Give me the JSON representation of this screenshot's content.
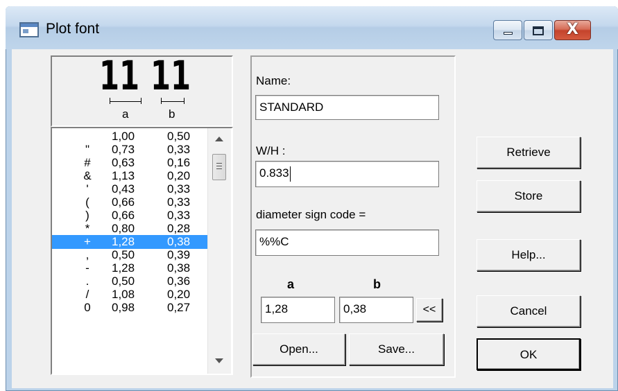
{
  "window": {
    "title": "Plot font",
    "minimize_label": "",
    "maximize_label": "",
    "close_label": "X"
  },
  "preview": {
    "sample_text": "11",
    "label_a": "a",
    "label_b": "b"
  },
  "char_list": {
    "rows": [
      {
        "char": "",
        "a": "1,00",
        "b": "0,50",
        "selected": false
      },
      {
        "char": "\"",
        "a": "0,73",
        "b": "0,33",
        "selected": false
      },
      {
        "char": "#",
        "a": "0,63",
        "b": "0,16",
        "selected": false
      },
      {
        "char": "&",
        "a": "1,13",
        "b": "0,20",
        "selected": false
      },
      {
        "char": "'",
        "a": "0,43",
        "b": "0,33",
        "selected": false
      },
      {
        "char": "(",
        "a": "0,66",
        "b": "0,33",
        "selected": false
      },
      {
        "char": ")",
        "a": "0,66",
        "b": "0,33",
        "selected": false
      },
      {
        "char": "*",
        "a": "0,80",
        "b": "0,28",
        "selected": false
      },
      {
        "char": "+",
        "a": "1,28",
        "b": "0,38",
        "selected": true
      },
      {
        "char": ",",
        "a": "0,50",
        "b": "0,39",
        "selected": false
      },
      {
        "char": "-",
        "a": "1,28",
        "b": "0,38",
        "selected": false
      },
      {
        "char": ".",
        "a": "0,50",
        "b": "0,36",
        "selected": false
      },
      {
        "char": "/",
        "a": "1,08",
        "b": "0,20",
        "selected": false
      },
      {
        "char": "0",
        "a": "0,98",
        "b": "0,27",
        "selected": false
      }
    ]
  },
  "form": {
    "name_label": "Name:",
    "name_value": "STANDARD",
    "wh_label": "W/H :",
    "wh_value": "0.833",
    "diameter_label": "diameter sign code =",
    "diameter_value": "%%C",
    "col_a_label": "a",
    "col_b_label": "b",
    "a_value": "1,28",
    "b_value": "0,38",
    "copy_button": "<<",
    "open_button": "Open...",
    "save_button": "Save..."
  },
  "buttons": {
    "retrieve": "Retrieve",
    "store": "Store",
    "help": "Help...",
    "cancel": "Cancel",
    "ok": "OK"
  }
}
